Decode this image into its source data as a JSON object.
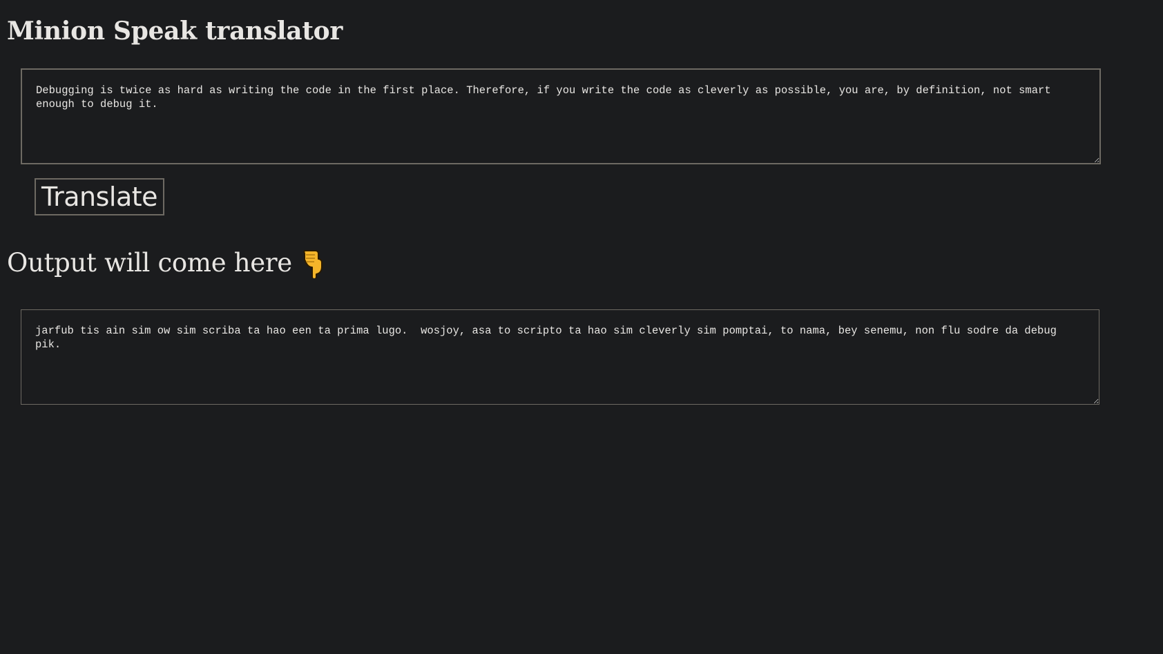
{
  "header": {
    "title": "Minion Speak translator"
  },
  "input": {
    "value": "Debugging is twice as hard as writing the code in the first place. Therefore, if you write the code as cleverly as possible, you are, by definition, not smart enough to debug it."
  },
  "actions": {
    "translate_label": "Translate"
  },
  "output": {
    "heading": "Output will come here",
    "icon": "pointing-down-hand-icon",
    "value": "jarfub tis ain sim ow sim scriba ta hao een ta prima lugo.  wosjoy, asa to scripto ta hao sim cleverly sim pomptai, to nama, bey senemu, non flu sodre da debug pik."
  },
  "colors": {
    "background": "#1b1c1e",
    "text": "#e8e6e3",
    "border": "#6e6a63",
    "emoji_hand": "#f5b52a"
  }
}
